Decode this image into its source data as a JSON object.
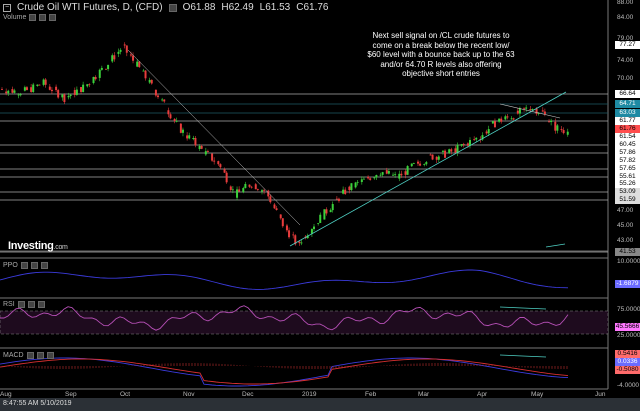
{
  "header": {
    "title": "Crude Oil WTI Futures, D, (CFD)",
    "open": "O61.88",
    "high": "H62.49",
    "low": "L61.53",
    "close": "C61.76"
  },
  "volume_label": "Volume",
  "note": "Next sell signal on /CL crude futures to come on a break below the recent low/ $60 level with a bounce back up to the 63 and/or 64.70 R levels also offering objective short entries",
  "logo": {
    "main": "Investing",
    "suffix": ".com"
  },
  "indicators": {
    "ppo": "PPO",
    "rsi": "RSI",
    "macd": "MACD"
  },
  "price_axis": [
    "88.00",
    "84.00",
    "79.00",
    "74.00",
    "70.00",
    "47.00",
    "45.00",
    "43.00"
  ],
  "price_boxes": [
    {
      "v": "77.27",
      "bg": "#ffffff"
    },
    {
      "v": "66.64",
      "bg": "#ffffff"
    },
    {
      "v": "64.71",
      "bg": "#1e8aa3"
    },
    {
      "v": "63.03",
      "bg": "#1e8aa3"
    },
    {
      "v": "61.77",
      "bg": "#ffffff"
    },
    {
      "v": "61.76",
      "bg": "#ff4d4d"
    },
    {
      "v": "61.54",
      "bg": "#ffffff"
    },
    {
      "v": "60.45",
      "bg": "#ffffff"
    },
    {
      "v": "57.86",
      "bg": "#ffffff"
    },
    {
      "v": "57.82",
      "bg": "#ffffff"
    },
    {
      "v": "57.65",
      "bg": "#ffffff"
    },
    {
      "v": "55.61",
      "bg": "#ffffff"
    },
    {
      "v": "55.26",
      "bg": "#ffffff"
    },
    {
      "v": "53.09",
      "bg": "#dddddd"
    },
    {
      "v": "51.59",
      "bg": "#dddddd"
    },
    {
      "v": "41.53",
      "bg": "#888888"
    }
  ],
  "ppo_axis": {
    "top": "10.0000",
    "value": "-1.6879"
  },
  "rsi_axis": {
    "top": "75.0000",
    "value": "45.5666",
    "bottom": "25.0000"
  },
  "macd_axis": {
    "v1": "0.5416",
    "v2": "0.0336",
    "v3": "-0.5080",
    "bottom": "-4.0000"
  },
  "x_axis": [
    "Aug",
    "Sep",
    "Oct",
    "Nov",
    "Dec",
    "2019",
    "Feb",
    "Mar",
    "Apr",
    "May",
    "Jun"
  ],
  "status": "8:47:55 AM 5/10/2019",
  "chart_data": {
    "type": "candlestick",
    "anchors": [
      [
        0,
        69
      ],
      [
        10,
        68.5
      ],
      [
        20,
        70
      ],
      [
        30,
        67.5
      ],
      [
        40,
        69.5
      ],
      [
        50,
        73
      ],
      [
        58,
        76.2
      ],
      [
        65,
        73
      ],
      [
        75,
        68
      ],
      [
        85,
        62.5
      ],
      [
        95,
        59
      ],
      [
        105,
        56
      ],
      [
        112,
        51
      ],
      [
        120,
        53
      ],
      [
        127,
        51.5
      ],
      [
        135,
        46
      ],
      [
        142,
        42.5
      ],
      [
        150,
        46
      ],
      [
        158,
        49
      ],
      [
        166,
        52
      ],
      [
        174,
        53.5
      ],
      [
        182,
        55
      ],
      [
        190,
        54
      ],
      [
        198,
        56
      ],
      [
        206,
        57.5
      ],
      [
        214,
        58
      ],
      [
        222,
        59.5
      ],
      [
        230,
        61
      ],
      [
        238,
        63.5
      ],
      [
        246,
        64.5
      ],
      [
        254,
        66
      ],
      [
        260,
        65
      ],
      [
        266,
        62.5
      ],
      [
        272,
        61.8
      ]
    ],
    "levels": [
      66.64,
      64.71,
      63.03,
      61.77,
      60.45,
      57.86,
      57.65,
      55.61,
      53.09,
      51.59,
      41.53
    ],
    "colors": {
      "up": "#3bd13b",
      "down": "#e83c3c",
      "trend": "#4fd1c5"
    }
  }
}
